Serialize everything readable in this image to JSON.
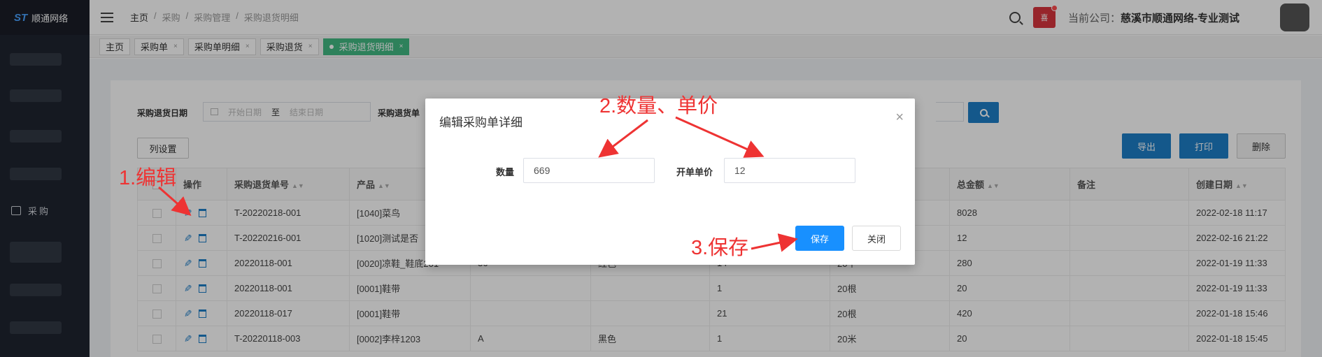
{
  "app": {
    "logo_mark": "ST",
    "logo_text": "顺通网络"
  },
  "sidebar": {
    "menu_purchase": "采购"
  },
  "header": {
    "breadcrumb": [
      "主页",
      "/",
      "采购",
      "/",
      "采购管理",
      "/",
      "采购退货明细"
    ],
    "company_label": "当前公司：",
    "company_name": "慈溪市顺通网络-专业测试",
    "bell_text": "喜"
  },
  "tabs": [
    {
      "label": "主页"
    },
    {
      "label": "采购单"
    },
    {
      "label": "采购单明细"
    },
    {
      "label": "采购退货"
    },
    {
      "label": "采购退货明细"
    }
  ],
  "tab_close_glyph": "×",
  "filter": {
    "date_label": "采购退货日期",
    "start_placeholder": "开始日期",
    "to": "至",
    "end_placeholder": "结束日期",
    "order_label": "采购退货单"
  },
  "toolbar": {
    "columns": "列设置",
    "export": "导出",
    "print": "打印",
    "delete": "删除"
  },
  "table": {
    "headers": [
      "",
      "操作",
      "采购退货单号",
      "产品",
      "",
      "",
      "",
      "",
      "总金额",
      "备注",
      "创建日期"
    ],
    "rows": [
      [
        "",
        "",
        "T-20220218-001",
        "[1040]菜鸟",
        "",
        "",
        "",
        "",
        "8028",
        "",
        "2022-02-18 11:17"
      ],
      [
        "",
        "",
        "T-20220216-001",
        "[1020]测试是否",
        "",
        "",
        "",
        "",
        "12",
        "",
        "2022-02-16 21:22"
      ],
      [
        "",
        "",
        "20220118-001",
        "[0020]凉鞋_鞋底201",
        "36",
        "红色",
        "14",
        "20个",
        "280",
        "",
        "2022-01-19 11:33"
      ],
      [
        "",
        "",
        "20220118-001",
        "[0001]鞋带",
        "",
        "",
        "1",
        "20根",
        "20",
        "",
        "2022-01-19 11:33"
      ],
      [
        "",
        "",
        "20220118-017",
        "[0001]鞋带",
        "",
        "",
        "21",
        "20根",
        "420",
        "",
        "2022-01-18 15:46"
      ],
      [
        "",
        "",
        "T-20220118-003",
        "[0002]李梓1203",
        "A",
        "黑色",
        "1",
        "20米",
        "20",
        "",
        "2022-01-18 15:45"
      ]
    ]
  },
  "modal": {
    "title": "编辑采购单详细",
    "qty_label": "数量",
    "qty_value": "669",
    "price_label": "开单单价",
    "price_value": "12",
    "save": "保存",
    "close": "关闭",
    "close_icon": "×"
  },
  "annotations": {
    "step1": "1.编辑",
    "step2": "2.数量、单价",
    "step3": "3.保存",
    "color": "#ee3333"
  }
}
